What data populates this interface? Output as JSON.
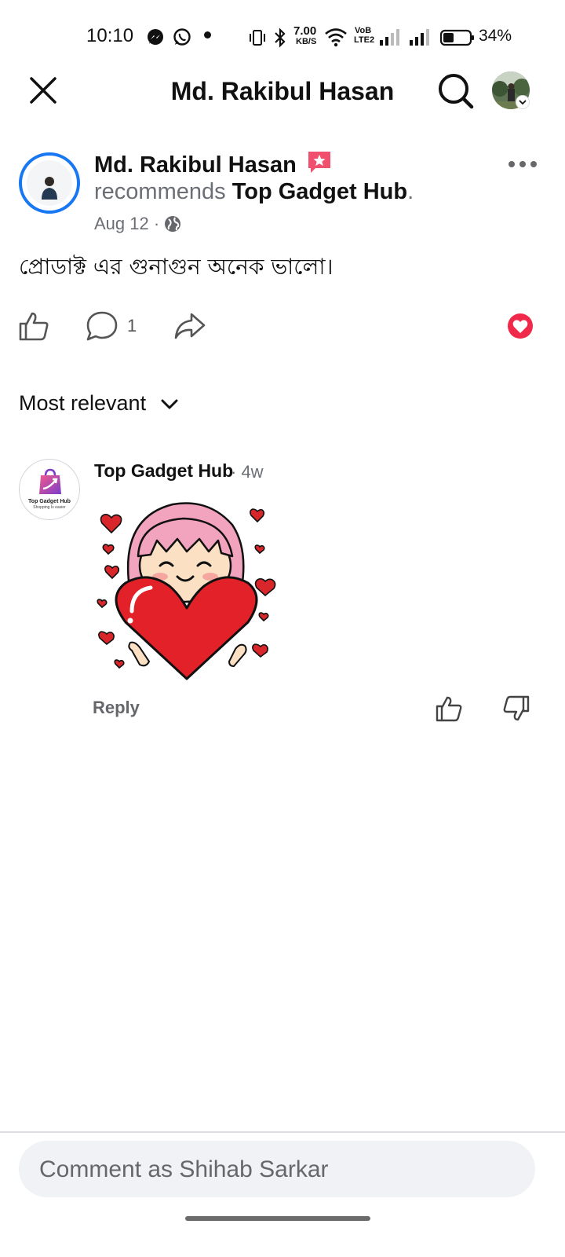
{
  "status_bar": {
    "time": "10:10",
    "net_speed_value": "7.00",
    "net_speed_unit": "KB/S",
    "volte_top": "VoB",
    "volte_bottom": "LTE2",
    "battery_percent": "34%"
  },
  "header": {
    "title": "Md. Rakibul Hasan",
    "close_icon": "close-icon",
    "search_icon": "search-icon"
  },
  "post": {
    "author": "Md. Rakibul Hasan",
    "recommends_prefix": "recommends",
    "page_name": "Top Gadget Hub",
    "date": "Aug 12",
    "text": "প্রোডাক্ট এর গুনাগুন অনেক ভালো।",
    "comment_count": "1",
    "colors": {
      "reaction_love": "#f02849",
      "avatar_ring": "#1877f2",
      "badge": "#f0506e"
    }
  },
  "comments_sort": {
    "label": "Most relevant"
  },
  "comment": {
    "author": "Top Gadget Hub",
    "time": "· 4w",
    "logo_text": "Top Gadget Hub",
    "logo_tagline": "Shopping Is easier",
    "reply_label": "Reply"
  },
  "composer": {
    "placeholder": "Comment as Shihab Sarkar"
  }
}
